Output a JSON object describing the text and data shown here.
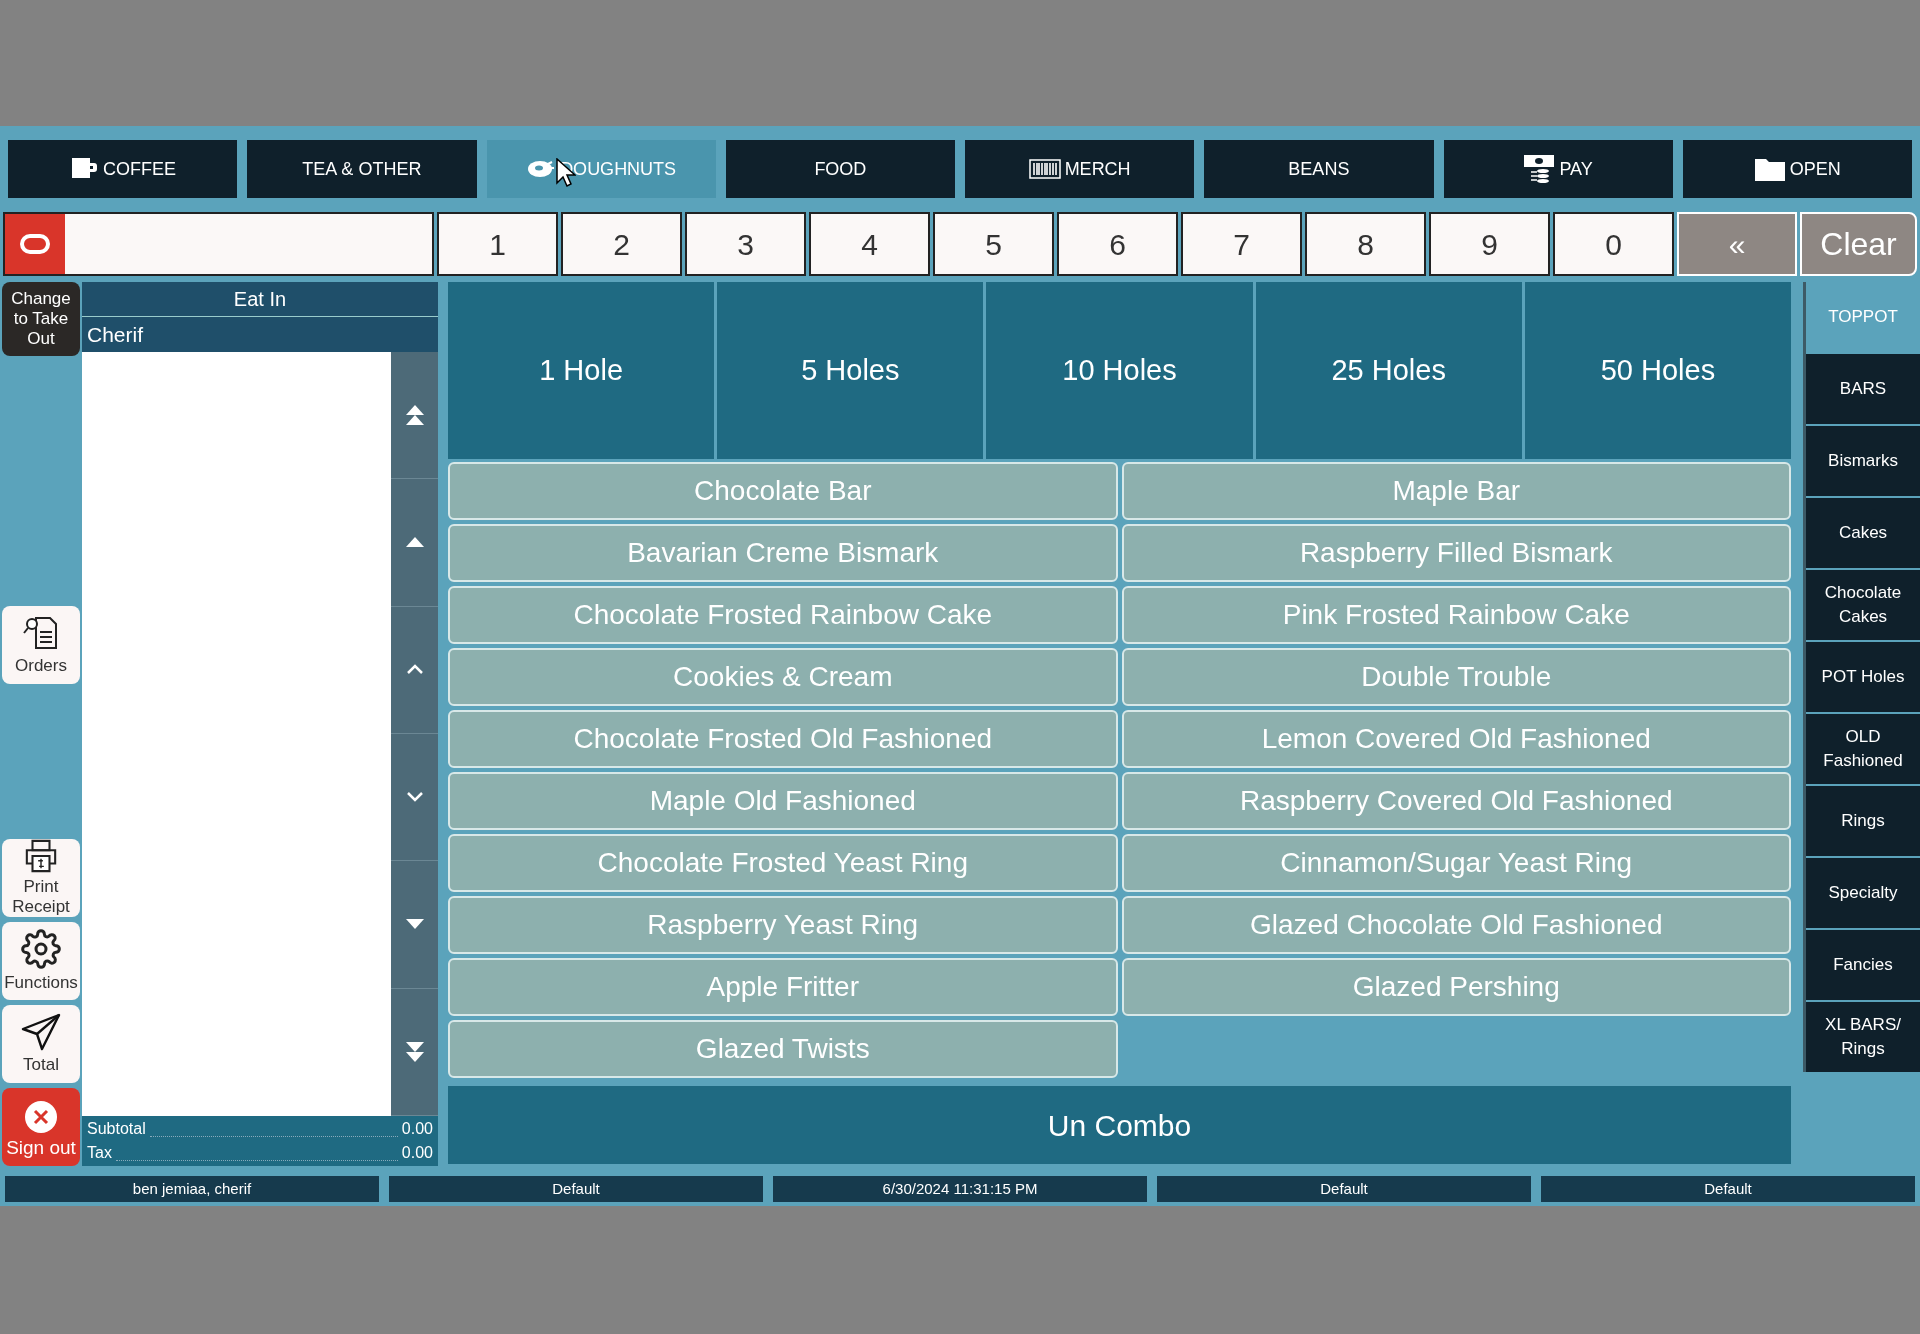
{
  "categories": [
    {
      "label": "COFFEE",
      "selected": false
    },
    {
      "label": "TEA & OTHER",
      "selected": false
    },
    {
      "label": "DOUGHNUTS",
      "selected": true
    },
    {
      "label": "FOOD",
      "selected": false
    },
    {
      "label": "MERCH",
      "selected": false
    },
    {
      "label": "BEANS",
      "selected": false
    },
    {
      "label": "PAY",
      "selected": false
    },
    {
      "label": "OPEN",
      "selected": false
    }
  ],
  "keypad": {
    "keys": [
      "1",
      "2",
      "3",
      "4",
      "5",
      "6",
      "7",
      "8",
      "9",
      "0"
    ],
    "backspace": "«",
    "clear": "Clear"
  },
  "left_actions": [
    {
      "label": "Change to Take Out",
      "kind": "dark"
    },
    {
      "label": "Orders",
      "kind": "orders"
    },
    {
      "label": "Print Receipt",
      "kind": "print"
    },
    {
      "label": "Functions",
      "kind": "functions"
    },
    {
      "label": "Total",
      "kind": "total"
    },
    {
      "label": "Sign out",
      "kind": "signout"
    }
  ],
  "order": {
    "mode": "Eat In",
    "customer": "Cherif",
    "subtotal_label": "Subtotal",
    "subtotal": "0.00",
    "tax_label": "Tax",
    "tax": "0.00"
  },
  "holes": [
    "1 Hole",
    "5 Holes",
    "10 Holes",
    "25 Holes",
    "50 Holes"
  ],
  "items": [
    "Chocolate Bar",
    "Maple Bar",
    "Bavarian Creme Bismark",
    "Raspberry Filled Bismark",
    "Chocolate Frosted Rainbow Cake",
    "Pink Frosted Rainbow Cake",
    "Cookies & Cream",
    "Double Trouble",
    "Chocolate Frosted Old Fashioned",
    "Lemon Covered Old Fashioned",
    "Maple Old Fashioned",
    "Raspberry Covered Old Fashioned",
    "Chocolate Frosted Yeast Ring",
    "Cinnamon/Sugar Yeast Ring",
    "Raspberry Yeast Ring",
    "Glazed Chocolate Old Fashioned",
    "Apple Fritter",
    "Glazed Pershing",
    "Glazed Twists"
  ],
  "combo_button": "Un Combo",
  "subcategories": [
    {
      "label": "TOPPOT",
      "selected": true
    },
    {
      "label": "BARS",
      "selected": false
    },
    {
      "label": "Bismarks",
      "selected": false
    },
    {
      "label": "Cakes",
      "selected": false
    },
    {
      "label": "Chocolate Cakes",
      "selected": false
    },
    {
      "label": "POT Holes",
      "selected": false
    },
    {
      "label": "OLD Fashioned",
      "selected": false
    },
    {
      "label": "Rings",
      "selected": false
    },
    {
      "label": "Specialty",
      "selected": false
    },
    {
      "label": "Fancies",
      "selected": false
    },
    {
      "label": "XL BARS/ Rings",
      "selected": false
    }
  ],
  "status_bar": [
    "ben jemiaa, cherif",
    "Default",
    "6/30/2024 11:31:15 PM",
    "Default",
    "Default"
  ]
}
